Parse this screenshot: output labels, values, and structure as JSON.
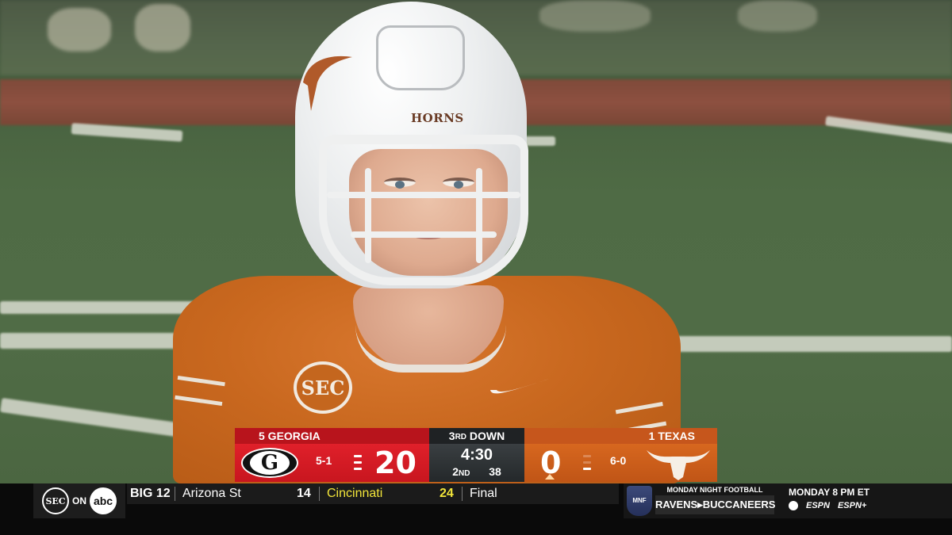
{
  "helmet": {
    "wordmark": "HORNS"
  },
  "jersey": {
    "patch": "SEC"
  },
  "scorebug": {
    "home": {
      "rank_name": "5 GEORGIA",
      "logo_letter": "G",
      "record": "5-1",
      "score": "20",
      "color": "#c8161f"
    },
    "away": {
      "rank_name": "1 TEXAS",
      "record": "6-0",
      "score": "0",
      "color": "#c6561c"
    },
    "down_num": "3",
    "down_suffix": "RD",
    "down_word": " DOWN",
    "clock": "4:30",
    "quarter_num": "2",
    "quarter_suffix": "ND",
    "play_clock": "38"
  },
  "network": {
    "sec_label": "SEC",
    "on_label": "ON",
    "abc_label": "abc"
  },
  "ticker": {
    "conference": "BIG 12",
    "team1": "Arizona St",
    "score1": "14",
    "team2": "Cincinnati",
    "score2": "24",
    "status": "Final"
  },
  "promo": {
    "badge": "MNF",
    "header": "MONDAY NIGHT FOOTBALL",
    "matchup": "RAVENS▸BUCCANEERS",
    "time": "MONDAY 8 PM ET",
    "net1": "ESPN",
    "net2": "ESPN+"
  }
}
